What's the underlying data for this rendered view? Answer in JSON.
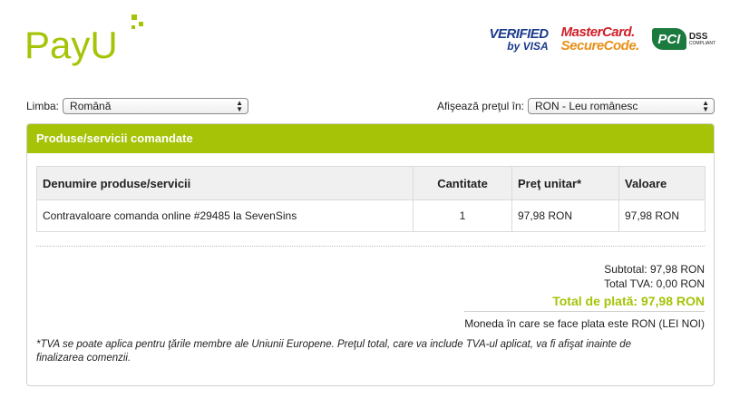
{
  "brand": {
    "logo_text": "PayU",
    "accent": "#a6c307"
  },
  "badges": {
    "visa_line1": "VERIFIED",
    "visa_line2": "by VISA",
    "mc_line1": "MasterCard.",
    "mc_line2": "SecureCode.",
    "pci_mark": "PCI",
    "pci_dss": "DSS",
    "pci_compliant": "COMPLIANT"
  },
  "language": {
    "label": "Limba:",
    "selected": "Română"
  },
  "currency": {
    "label": "Afişează preţul în:",
    "selected": "RON - Leu românesc"
  },
  "panel": {
    "title": "Produse/servicii comandate",
    "columns": [
      "Denumire produse/servicii",
      "Cantitate",
      "Preţ unitar*",
      "Valoare"
    ],
    "rows": [
      {
        "name": "Contravaloare comanda online #29485 la SevenSins",
        "qty": "1",
        "unit_price": "97,98 RON",
        "value": "97,98 RON"
      }
    ],
    "subtotal": "Subtotal: 97,98 RON",
    "vat": "Total TVA: 0,00 RON",
    "total": "Total de plată: 97,98 RON",
    "currency_note": "Moneda în care se face plata este RON (LEI NOI)",
    "footnote": "*TVA se poate aplica pentru ţările membre ale Uniunii Europene. Preţul total, care va include TVA-ul aplicat, va fi afişat inainte de finalizarea comenzii."
  }
}
